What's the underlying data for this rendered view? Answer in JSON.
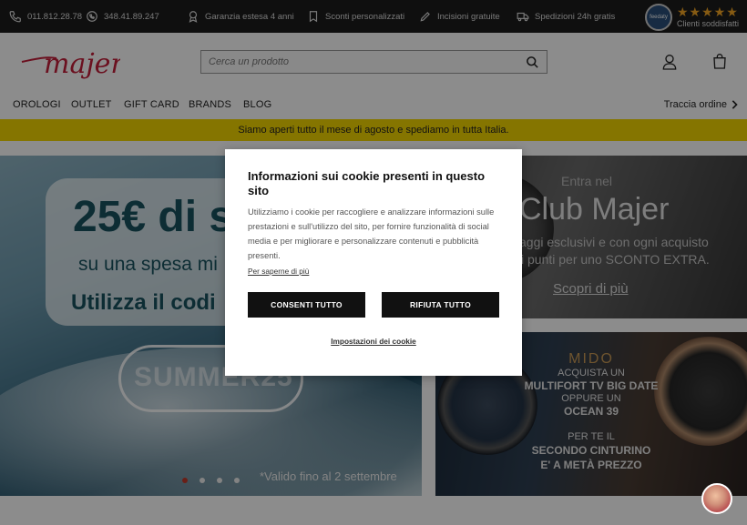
{
  "topbar": {
    "phone": "011.812.28.78",
    "whatsapp": "348.41.89.247",
    "warranty": "Garanzia estesa 4 anni",
    "discounts": "Sconti personalizzati",
    "engraving": "Incisioni gratuite",
    "shipping": "Spedizioni 24h gratis",
    "feedaty_badge": "feedaty",
    "rating_stars": "★★★★★",
    "rating_label": "Clienti soddisfatti"
  },
  "header": {
    "logo_text": "majer",
    "search_placeholder": "Cerca un prodotto"
  },
  "nav": {
    "items": [
      "OROLOGI",
      "OUTLET",
      "GIFT CARD",
      "BRANDS",
      "BLOG"
    ],
    "track_order": "Traccia ordine"
  },
  "notice": "Siamo aperti tutto il mese di agosto e spediamo in tutta Italia.",
  "hero": {
    "title": "25€ di s",
    "subtitle": "su una spesa mi",
    "cta": "Utilizza il codi",
    "code": "SUMMER25",
    "note": "*Valido fino al 2 settembre",
    "slides": 4,
    "active_slide": 1
  },
  "club": {
    "kicker": "Entra nel",
    "title": "Club Majer",
    "desc_line1": "aggi esclusivi e con ogni acquisto",
    "desc_line2": "i punti per uno SCONTO EXTRA.",
    "link": "Scopri di più"
  },
  "mido": {
    "brand": "MIDO",
    "line1": "ACQUISTA UN",
    "line2": "MULTIFORT TV BIG DATE",
    "line3": "OPPURE UN",
    "line4": "OCEAN 39",
    "line5": "PER TE IL",
    "line6": "SECONDO CINTURINO",
    "line7": "E' A METÀ PREZZO"
  },
  "cookie_modal": {
    "title": "Informazioni sui cookie presenti in questo sito",
    "body": "Utilizziamo i cookie per raccogliere e analizzare informazioni sulle prestazioni e sull'utilizzo del sito, per fornire funzionalità di social media e per migliorare e personalizzare contenuti e pubblicità presenti.",
    "learn_more": "Per saperne di più",
    "accept_all": "CONSENTI TUTTO",
    "reject_all": "RIFIUTA TUTTO",
    "settings": "Impostazioni dei cookie"
  },
  "colors": {
    "topbar_bg": "#1c1c1c",
    "notice_bg": "#f2d500",
    "logo_red": "#c41e3a",
    "button_bg": "#111111",
    "hero_text": "#19525f",
    "mido_gold": "#c99a55"
  }
}
